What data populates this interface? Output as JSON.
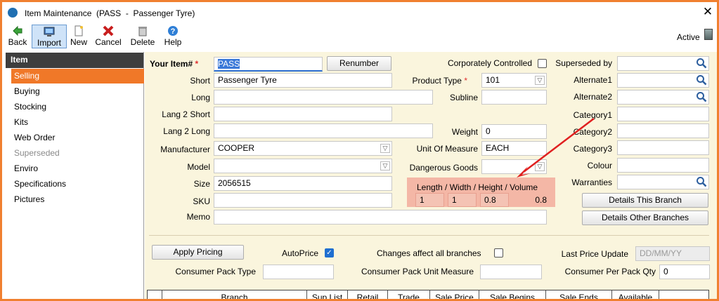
{
  "window": {
    "title": "Item Maintenance  (PASS  -  Passenger Tyre)",
    "close": "✕"
  },
  "toolbar": {
    "back": "Back",
    "import": "Import",
    "new": "New",
    "cancel": "Cancel",
    "delete": "Delete",
    "help": "Help",
    "status": "Active"
  },
  "sidebar": {
    "header": "Item",
    "items": [
      "Selling",
      "Buying",
      "Stocking",
      "Kits",
      "Web Order",
      "Superseded",
      "Enviro",
      "Specifications",
      "Pictures"
    ]
  },
  "form": {
    "your_item_label": "Your Item#",
    "your_item_value": "PASS",
    "renumber": "Renumber",
    "short_label": "Short",
    "short_value": "Passenger Tyre",
    "long_label": "Long",
    "long_value": "",
    "lang2_short_label": "Lang 2 Short",
    "lang2_short_value": "",
    "lang2_long_label": "Lang 2 Long",
    "lang2_long_value": "",
    "manufacturer_label": "Manufacturer",
    "manufacturer_value": "COOPER",
    "model_label": "Model",
    "model_value": "",
    "size_label": "Size",
    "size_value": "2056515",
    "sku_label": "SKU",
    "sku_value": "",
    "memo_label": "Memo",
    "memo_value": "",
    "corp_controlled_label": "Corporately Controlled",
    "corp_controlled_checked": false,
    "product_type_label": "Product Type",
    "product_type_value": "101",
    "subline_label": "Subline",
    "subline_value": "",
    "weight_label": "Weight",
    "weight_value": "0",
    "uom_label": "Unit Of Measure",
    "uom_value": "EACH",
    "dangerous_goods_label": "Dangerous Goods",
    "dangerous_goods_value": "",
    "dimensions_label": "Length / Width / Height / Volume",
    "length_value": "1",
    "width_value": "1",
    "height_value": "0.8",
    "volume_value": "0.8",
    "superseded_by_label": "Superseded by",
    "superseded_by_value": "",
    "alternate1_label": "Alternate1",
    "alternate1_value": "",
    "alternate2_label": "Alternate2",
    "alternate2_value": "",
    "category1_label": "Category1",
    "category1_value": "",
    "category2_label": "Category2",
    "category2_value": "",
    "category3_label": "Category3",
    "category3_value": "",
    "colour_label": "Colour",
    "colour_value": "",
    "warranties_label": "Warranties",
    "warranties_value": "",
    "details_this_branch": "Details This Branch",
    "details_other_branches": "Details Other Branches"
  },
  "pricing": {
    "apply_pricing": "Apply Pricing",
    "autoprice_label": "AutoPrice",
    "autoprice_checked": true,
    "changes_all_label": "Changes affect all branches",
    "changes_all_checked": false,
    "last_price_update_label": "Last Price Update",
    "last_price_update_placeholder": "DD/MM/YY",
    "consumer_pack_type_label": "Consumer Pack Type",
    "consumer_pack_type_value": "",
    "consumer_pack_uom_label": "Consumer Pack Unit Measure",
    "consumer_pack_uom_value": "",
    "consumer_per_pack_qty_label": "Consumer Per Pack Qty",
    "consumer_per_pack_qty_value": "0"
  },
  "grid": {
    "columns": [
      "Branch",
      "Sup List",
      "Retail",
      "Trade",
      "Sale Price",
      "Sale Begins",
      "Sale Ends",
      "Available"
    ]
  },
  "colors": {
    "accent": "#f07828",
    "annotation_arrow": "#e02020",
    "highlight_panel": "#f4b7a6",
    "form_bg": "#faf5dd"
  }
}
